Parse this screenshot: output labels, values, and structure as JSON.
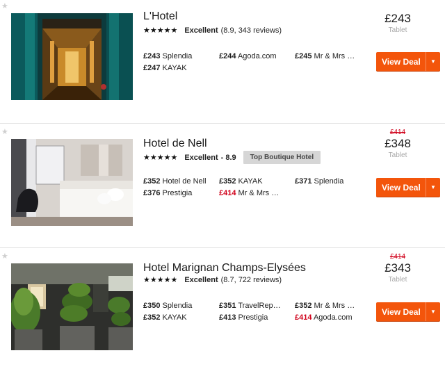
{
  "tablet_label": "Tablet",
  "view_deal_label": "View Deal",
  "hotels": [
    {
      "name": "L'Hotel",
      "stars": "★★★★★",
      "rating_word": "Excellent",
      "rating_detail": "(8.9, 343 reviews)",
      "badge": "",
      "old_price": "",
      "price": "£243",
      "offers": [
        {
          "price": "£243",
          "provider": "Splendia",
          "red": false
        },
        {
          "price": "£244",
          "provider": "Agoda.com",
          "red": false
        },
        {
          "price": "£245",
          "provider": "Mr & Mrs …",
          "red": false
        },
        {
          "price": "£247",
          "provider": "KAYAK",
          "red": false
        }
      ]
    },
    {
      "name": "Hotel de Nell",
      "stars": "★★★★★",
      "rating_word": "Excellent",
      "rating_detail": "- 8.9",
      "badge": "Top Boutique Hotel",
      "old_price": "£414",
      "price": "£348",
      "offers": [
        {
          "price": "£352",
          "provider": "Hotel de Nell",
          "red": false
        },
        {
          "price": "£352",
          "provider": "KAYAK",
          "red": false
        },
        {
          "price": "£371",
          "provider": "Splendia",
          "red": false
        },
        {
          "price": "£376",
          "provider": "Prestigia",
          "red": false
        },
        {
          "price": "£414",
          "provider": "Mr & Mrs …",
          "red": true
        }
      ]
    },
    {
      "name": "Hotel Marignan Champs-Elysées",
      "stars": "★★★★★",
      "rating_word": "Excellent",
      "rating_detail": "(8.7, 722 reviews)",
      "badge": "",
      "old_price": "£414",
      "price": "£343",
      "offers": [
        {
          "price": "£350",
          "provider": "Splendia",
          "red": false
        },
        {
          "price": "£351",
          "provider": "TravelRep…",
          "red": false
        },
        {
          "price": "£352",
          "provider": "Mr & Mrs …",
          "red": false
        },
        {
          "price": "£352",
          "provider": "KAYAK",
          "red": false
        },
        {
          "price": "£413",
          "provider": "Prestigia",
          "red": false
        },
        {
          "price": "£414",
          "provider": "Agoda.com",
          "red": true
        }
      ]
    }
  ],
  "colors": {
    "deal_button": "#f3550b",
    "strike_price": "#d0021b",
    "badge_bg": "#d6d6d6"
  }
}
